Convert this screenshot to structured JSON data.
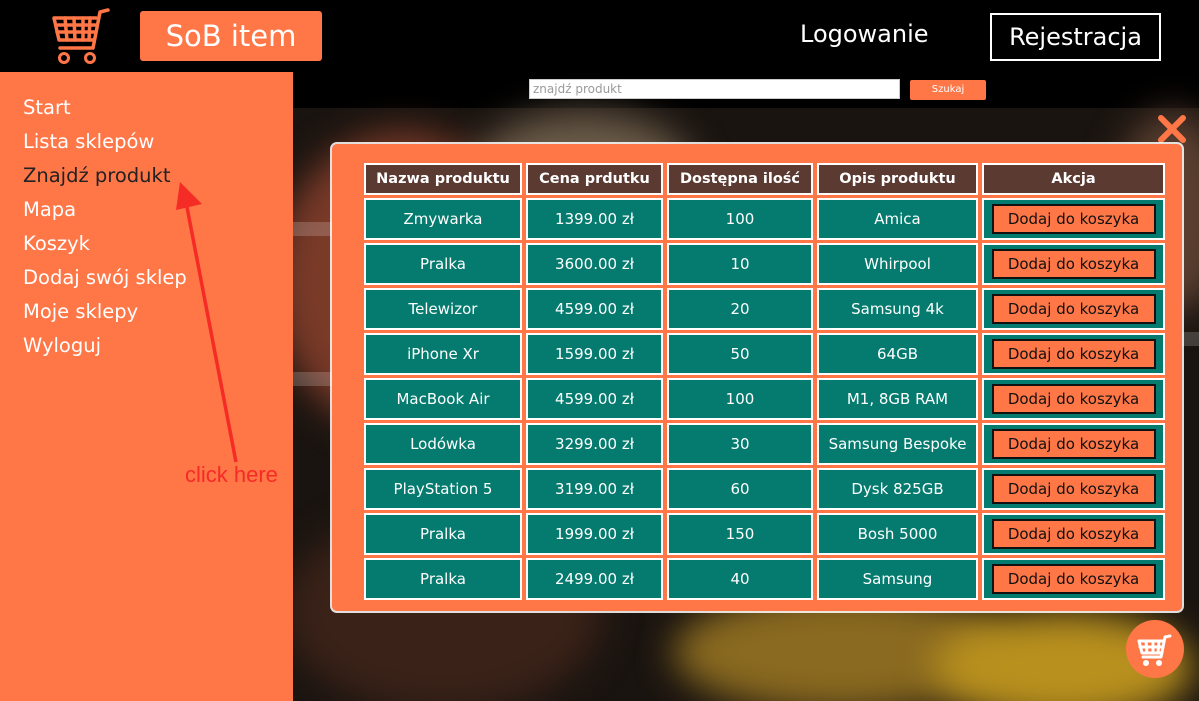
{
  "header": {
    "brand": "SoB item",
    "login": "Logowanie",
    "register": "Rejestracja"
  },
  "sidebar": {
    "items": [
      {
        "label": "Start"
      },
      {
        "label": "Lista sklepów"
      },
      {
        "label": "Znajdź produkt"
      },
      {
        "label": "Mapa"
      },
      {
        "label": "Koszyk"
      },
      {
        "label": "Dodaj swój sklep"
      },
      {
        "label": "Moje sklepy"
      },
      {
        "label": "Wyloguj"
      }
    ],
    "annotation": "click here"
  },
  "search": {
    "placeholder": "znajdź produkt",
    "button": "Szukaj"
  },
  "table": {
    "headers": [
      "Nazwa produktu",
      "Cena prdutku",
      "Dostępna ilość",
      "Opis produktu",
      "Akcja"
    ],
    "rows": [
      {
        "name": "Zmywarka",
        "price": "1399.00 zł",
        "qty": "100",
        "desc": "Amica",
        "action": "Dodaj do koszyka"
      },
      {
        "name": "Pralka",
        "price": "3600.00 zł",
        "qty": "10",
        "desc": "Whirpool",
        "action": "Dodaj do koszyka"
      },
      {
        "name": "Telewizor",
        "price": "4599.00 zł",
        "qty": "20",
        "desc": "Samsung 4k",
        "action": "Dodaj do koszyka"
      },
      {
        "name": "iPhone Xr",
        "price": "1599.00 zł",
        "qty": "50",
        "desc": "64GB",
        "action": "Dodaj do koszyka"
      },
      {
        "name": "MacBook Air",
        "price": "4599.00 zł",
        "qty": "100",
        "desc": "M1, 8GB RAM",
        "action": "Dodaj do koszyka"
      },
      {
        "name": "Lodówka",
        "price": "3299.00 zł",
        "qty": "30",
        "desc": "Samsung Bespoke",
        "action": "Dodaj do koszyka"
      },
      {
        "name": "PlayStation 5",
        "price": "3199.00 zł",
        "qty": "60",
        "desc": "Dysk 825GB",
        "action": "Dodaj do koszyka"
      },
      {
        "name": "Pralka",
        "price": "1999.00 zł",
        "qty": "150",
        "desc": "Bosh 5000",
        "action": "Dodaj do koszyka"
      },
      {
        "name": "Pralka",
        "price": "2499.00 zł",
        "qty": "40",
        "desc": "Samsung",
        "action": "Dodaj do koszyka"
      }
    ]
  },
  "colors": {
    "accent": "#ff7647",
    "cell": "#047b6e",
    "header_cell": "#5b3a32",
    "annotation": "#f52b26"
  },
  "icons": [
    "cart-logo-icon",
    "close-icon",
    "cart-fab-icon"
  ]
}
